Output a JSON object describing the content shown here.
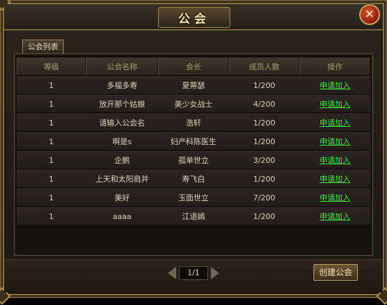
{
  "window": {
    "title": "公会"
  },
  "tabs": [
    {
      "label": "公会列表"
    }
  ],
  "table": {
    "headers": [
      "等级",
      "公会名称",
      "会长",
      "成员人数",
      "操作"
    ],
    "rows": [
      [
        "1",
        "多福多寿",
        "夏蒂瑟",
        "1/200",
        "申请加入"
      ],
      [
        "1",
        "放开那个姑娘",
        "美少女战士",
        "4/200",
        "申请加入"
      ],
      [
        "1",
        "请输入公会名",
        "浩轩",
        "1/200",
        "申请加入"
      ],
      [
        "1",
        "啊是s",
        "妇产科陈医生",
        "1/200",
        "申请加入"
      ],
      [
        "1",
        "企鹅",
        "孤单世立",
        "3/200",
        "申请加入"
      ],
      [
        "1",
        "上天和太阳肩并",
        "寿飞白",
        "1/200",
        "申请加入"
      ],
      [
        "1",
        "美好",
        "玉面世立",
        "7/200",
        "申请加入"
      ],
      [
        "1",
        "aaaa",
        "江语嫣",
        "1/200",
        "申请加入"
      ]
    ]
  },
  "pager": {
    "text": "1/1"
  },
  "buttons": {
    "create": "创建公会"
  },
  "icons": {
    "close": "close-icon",
    "prev": "arrow-left-icon",
    "next": "arrow-right-icon"
  },
  "colors": {
    "join_link": "#3cf03c",
    "gold_border": "#c2a060"
  }
}
